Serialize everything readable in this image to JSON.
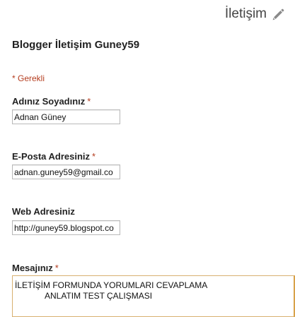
{
  "header": {
    "title": "İletişim",
    "edit_icon": "pencil-icon"
  },
  "form": {
    "title": "Blogger İletişim Guney59",
    "required_note": "* Gerekli",
    "fields": {
      "name": {
        "label": "Adınız Soyadınız",
        "required": "*",
        "value": "Adnan Güney"
      },
      "email": {
        "label": "E-Posta Adresiniz",
        "required": "*",
        "value": "adnan.guney59@gmail.co"
      },
      "web": {
        "label": "Web Adresiniz",
        "value": "http://guney59.blogspot.co"
      },
      "message": {
        "label": "Mesajınız",
        "required": "*",
        "line1": "İLETİŞİM FORMUNDA YORUMLARI CEVAPLAMA",
        "line2": "ANLATIM TEST ÇALIŞMASI"
      }
    }
  },
  "colors": {
    "required": "#b43c1e",
    "textarea_focus_border": "#d8a24a",
    "input_border": "#b9b9b9"
  }
}
